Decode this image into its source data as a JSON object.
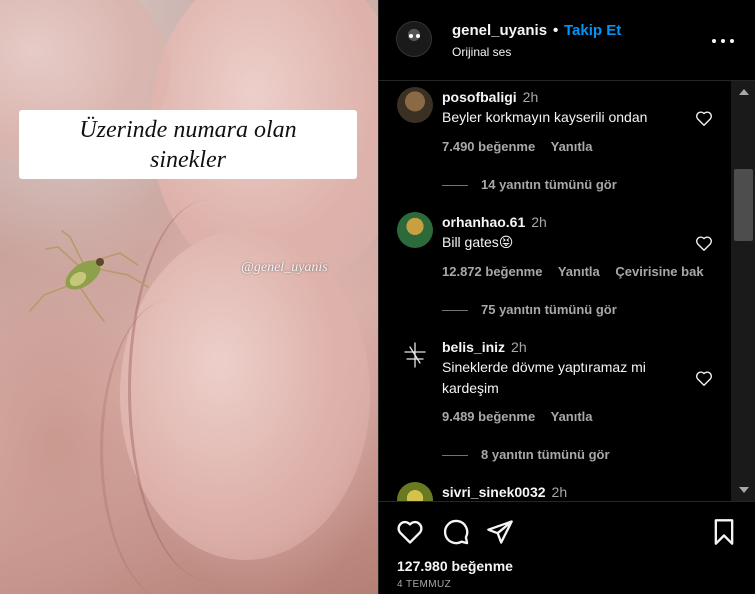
{
  "media": {
    "caption_line1": "Üzerinde numara olan",
    "caption_line2": "sinekler",
    "watermark": "@genel_uyanis"
  },
  "header": {
    "username": "genel_uyanis",
    "separator": "•",
    "follow_label": "Takip Et",
    "audio_label": "Orijinal ses",
    "more_icon": "more-horizontal-icon"
  },
  "comments": [
    {
      "username": "posofbaligi",
      "time": "2h",
      "text": "Beyler korkmayın kayserili ondan",
      "likes": "7.490 beğenme",
      "reply": "Yanıtla",
      "view_replies": "14 yanıtın tümünü gör"
    },
    {
      "username": "orhanhao.61",
      "time": "2h",
      "text": "Bill gates😝",
      "likes": "12.872 beğenme",
      "reply": "Yanıtla",
      "translate": "Çevirisine bak",
      "view_replies": "75 yanıtın tümünü gör"
    },
    {
      "username": "belis_iniz",
      "time": "2h",
      "text": "Sineklerde dövme yaptıramaz mi kardeşim",
      "likes": "9.489 beğenme",
      "reply": "Yanıtla",
      "view_replies": "8 yanıtın tümünü gör"
    },
    {
      "username": "sivri_sinek0032",
      "time": "2h"
    }
  ],
  "actions": {
    "like_icon": "heart-icon",
    "comment_icon": "comment-icon",
    "share_icon": "send-icon",
    "save_icon": "bookmark-icon",
    "likes": "127.980 beğenme",
    "date": "4 TEMMUZ"
  },
  "colors": {
    "background": "#000000",
    "link_blue": "#0095f6",
    "secondary_text": "#a8a8a8",
    "caption_bg": "#ffffff"
  }
}
